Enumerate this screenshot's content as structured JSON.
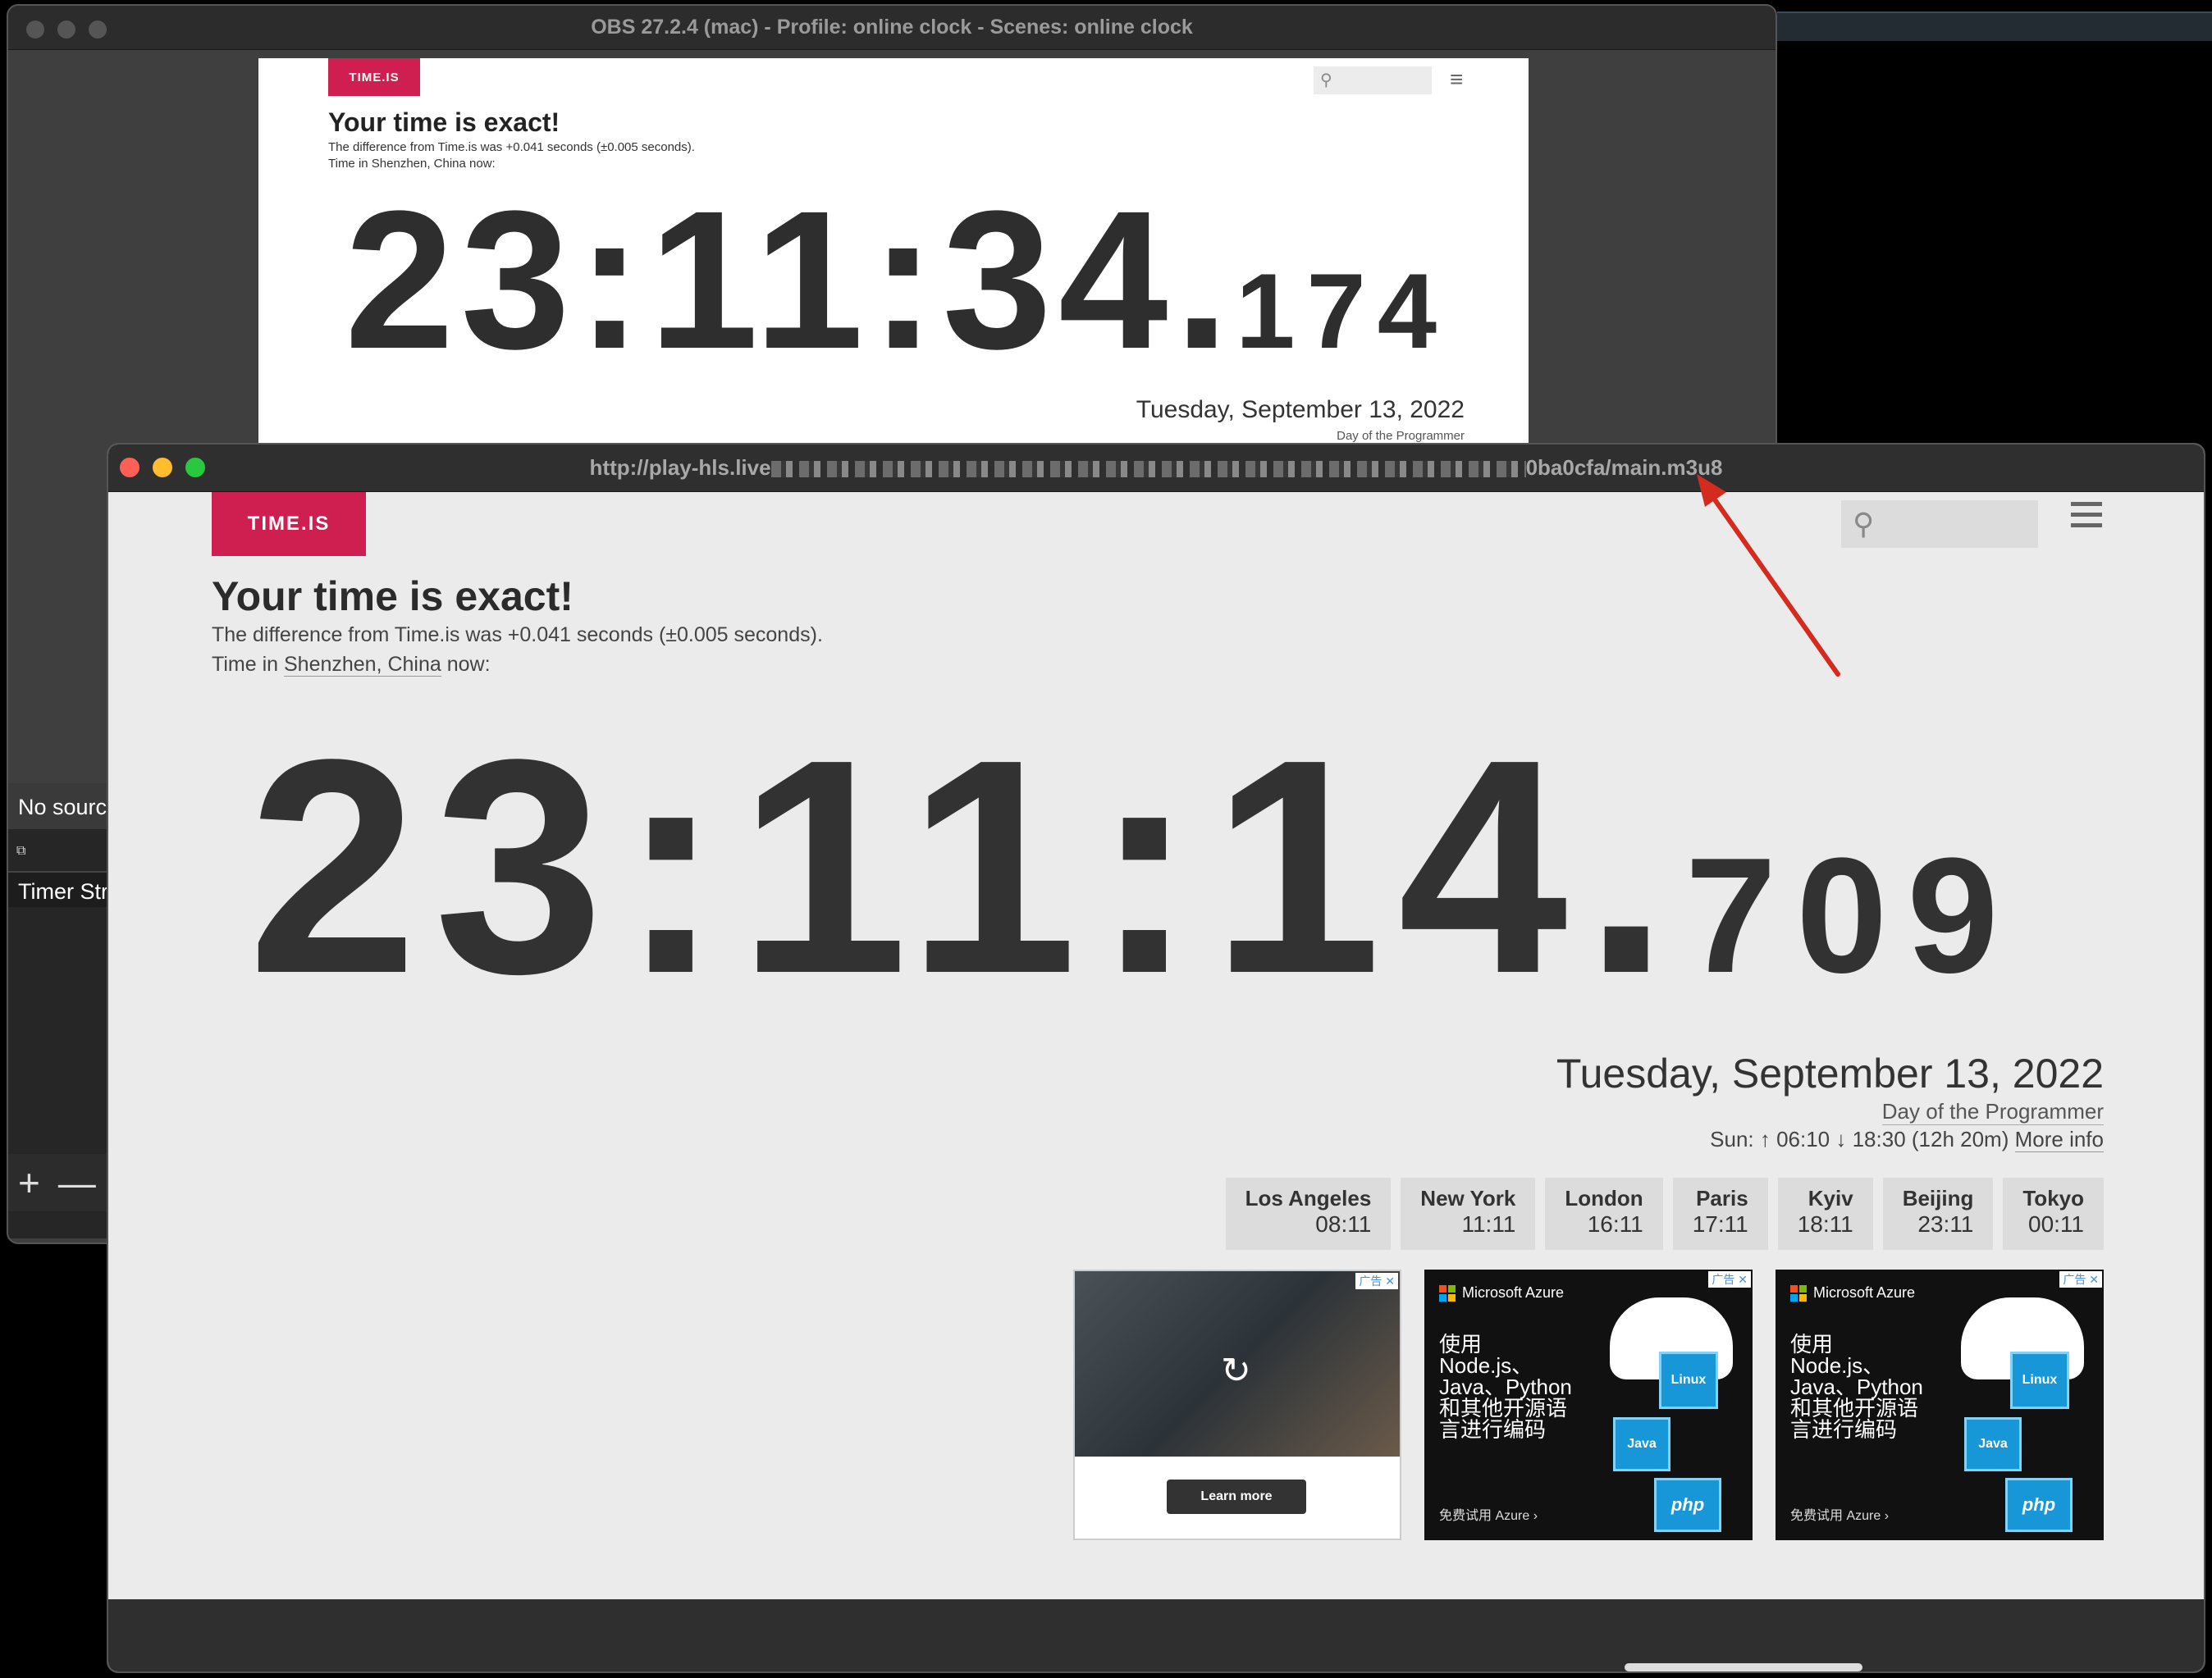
{
  "obs": {
    "title": "OBS 27.2.4 (mac) - Profile: online clock - Scenes: online clock",
    "no_source": "No source",
    "timer_item": "Timer Str",
    "add_label": "+",
    "remove_label": "—",
    "preview": {
      "logo": "TIME.IS",
      "heading": "Your time is exact!",
      "difference": "The difference from Time.is was +0.041 seconds (±0.005 seconds).",
      "place": "Time in Shenzhen, China now:",
      "clock_main": "23:11:34.",
      "clock_ms": "174",
      "date": "Tuesday, September 13, 2022",
      "day": "Day of the Programmer"
    }
  },
  "player": {
    "url_start": "http://play-hls.live",
    "url_end": "0ba0cfa/main.m3u8"
  },
  "timeis": {
    "logo": "TIME.IS",
    "heading": "Your time is exact!",
    "difference": "The difference from Time.is was +0.041 seconds (±0.005 seconds).",
    "place_prefix": "Time in ",
    "place_city": "Shenzhen, China",
    "place_suffix": " now:",
    "clock_main": "23:11:14.",
    "clock_ms": "709",
    "date": "Tuesday, September 13, 2022",
    "day": "Day of the Programmer",
    "sun": "Sun: ↑ 06:10 ↓ 18:30 (12h 20m)",
    "more_info": "More info",
    "cities": [
      {
        "name": "Los Angeles",
        "time": "08:11"
      },
      {
        "name": "New York",
        "time": "11:11"
      },
      {
        "name": "London",
        "time": "16:11"
      },
      {
        "name": "Paris",
        "time": "17:11"
      },
      {
        "name": "Kyiv",
        "time": "18:11"
      },
      {
        "name": "Beijing",
        "time": "23:11"
      },
      {
        "name": "Tokyo",
        "time": "00:11"
      }
    ],
    "ads": {
      "close": "广告 ✕",
      "learn_more": "Learn more",
      "azure_brand": "Microsoft Azure",
      "azure_text": "使用 Node.js、Java、Python 和其他开源语言进行编码",
      "azure_cta": "免费试用 Azure ›",
      "tile_linux": "Linux",
      "tile_java": "Java",
      "tile_php": "php"
    }
  },
  "colors": {
    "brand": "#cf1f50",
    "arrow": "#d42b1e"
  }
}
